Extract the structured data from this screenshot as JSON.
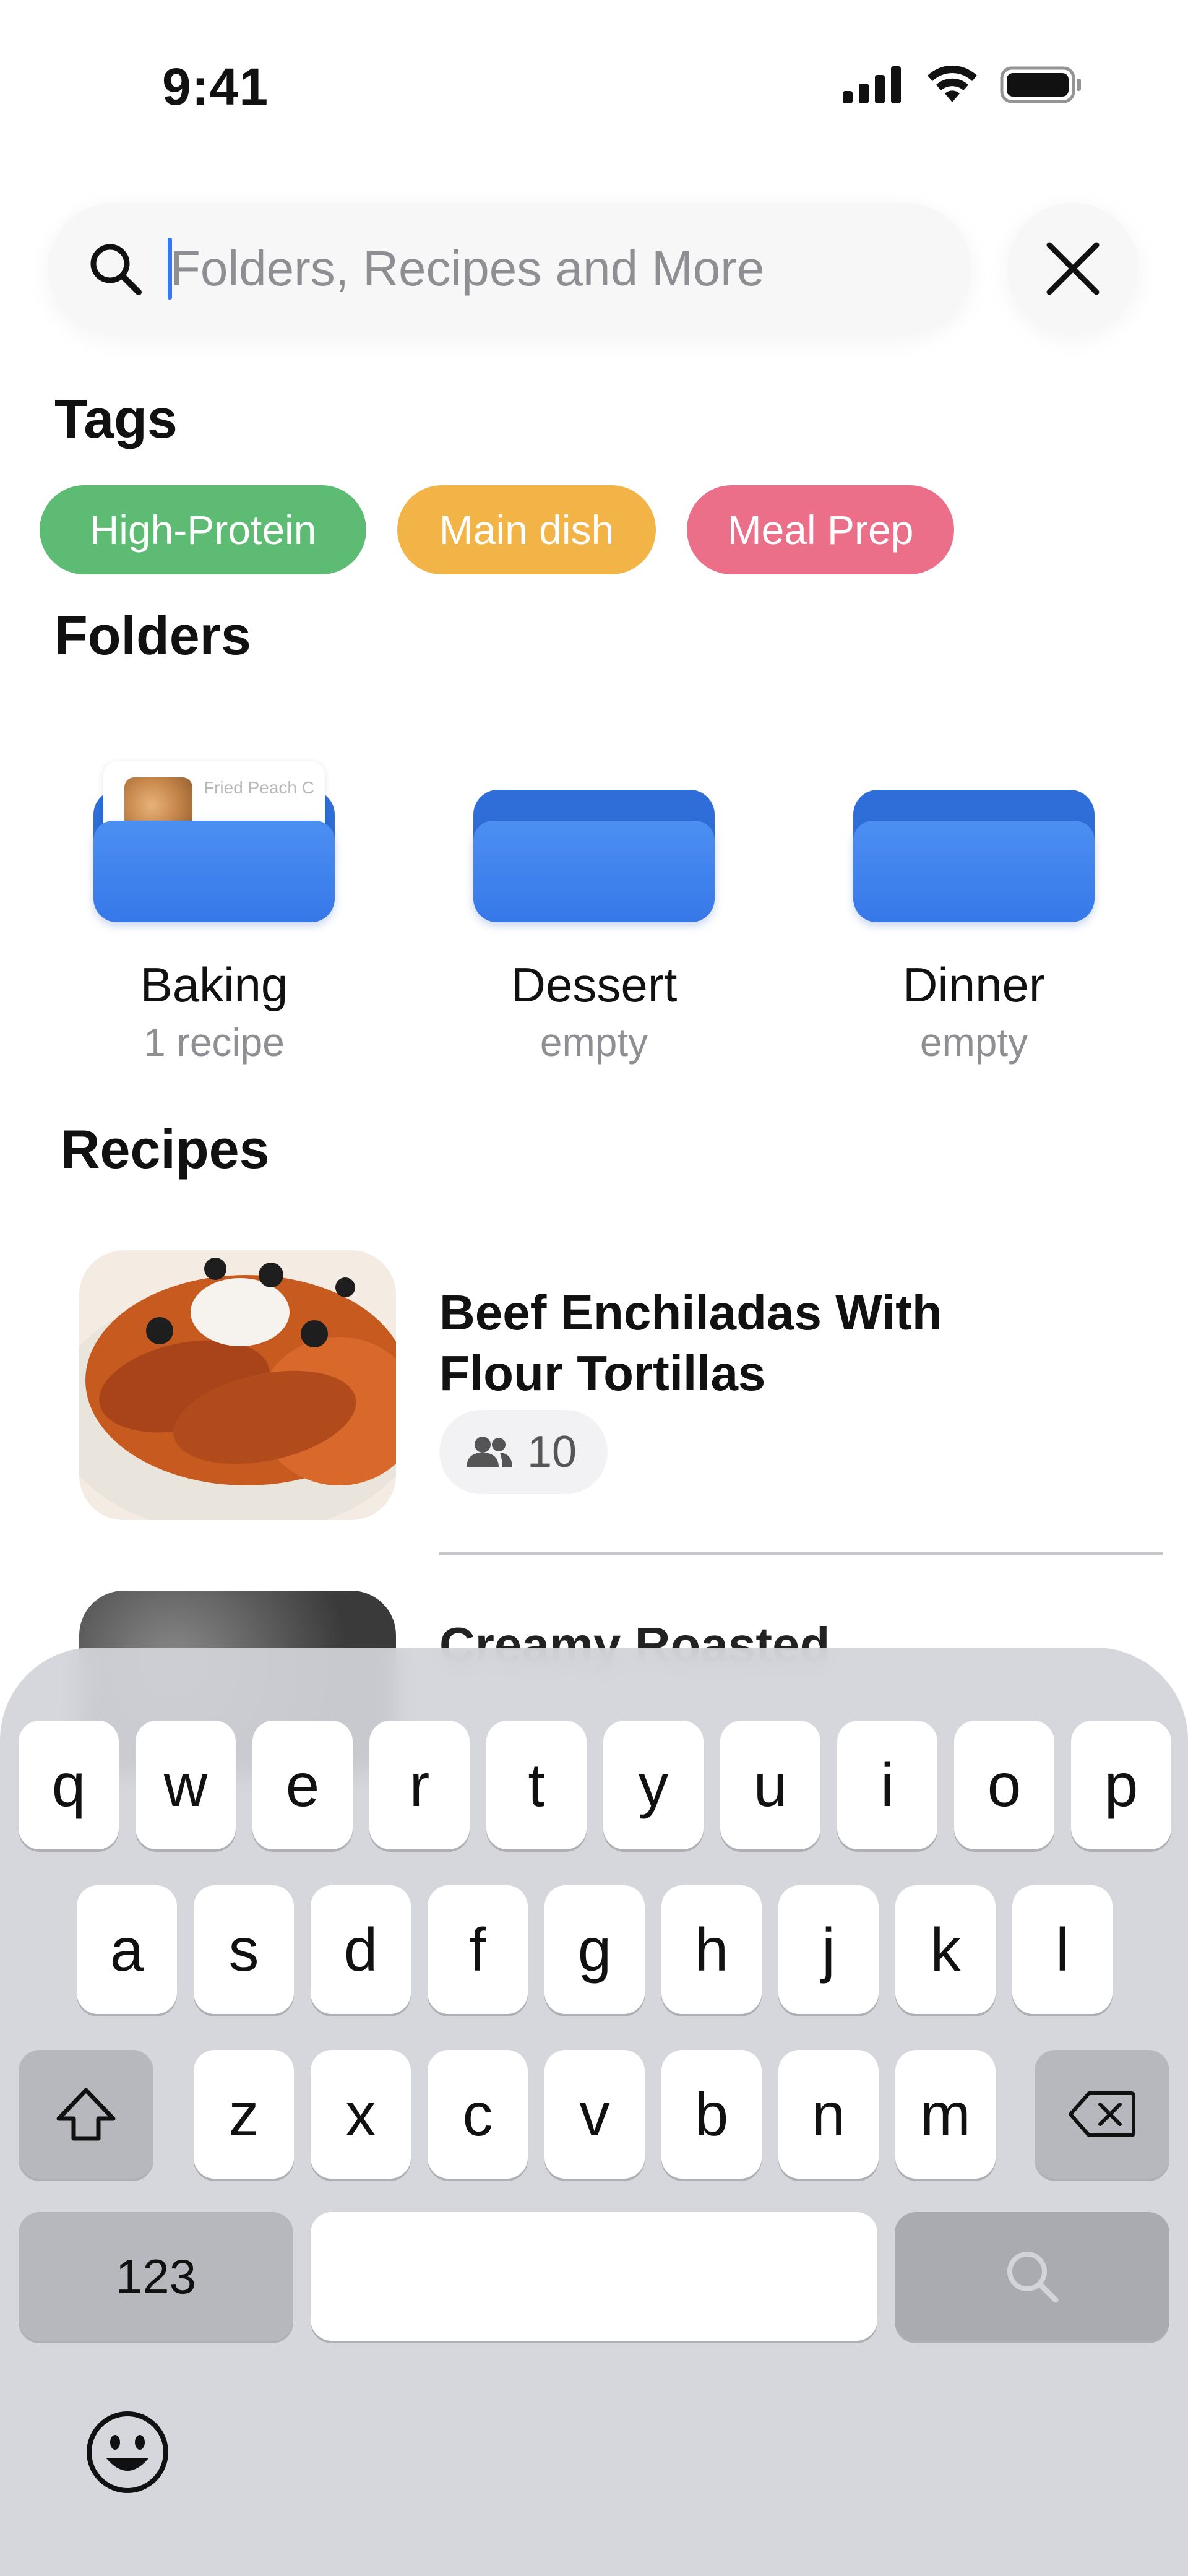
{
  "status_bar": {
    "time": "9:41"
  },
  "search": {
    "placeholder": "Folders, Recipes and More",
    "value": ""
  },
  "tags_section": {
    "title": "Tags",
    "tags": [
      {
        "label": "High-Protein",
        "color": "#5dbb73"
      },
      {
        "label": "Main dish",
        "color": "#f2b446"
      },
      {
        "label": "Meal Prep",
        "color": "#ec6f8a"
      }
    ]
  },
  "folders_section": {
    "title": "Folders",
    "folders": [
      {
        "name": "Baking",
        "count": "1 recipe",
        "preview_text": "Fried Peach Co..."
      },
      {
        "name": "Dessert",
        "count": "empty"
      },
      {
        "name": "Dinner",
        "count": "empty"
      }
    ]
  },
  "recipes_section": {
    "title": "Recipes",
    "items": [
      {
        "title": "Beef Enchiladas With Flour Tortillas",
        "servings": "10",
        "icon": "people-icon"
      },
      {
        "title": "Creamy Roasted"
      }
    ]
  },
  "keyboard": {
    "row1": [
      "q",
      "w",
      "e",
      "r",
      "t",
      "y",
      "u",
      "i",
      "o",
      "p"
    ],
    "row2": [
      "a",
      "s",
      "d",
      "f",
      "g",
      "h",
      "j",
      "k",
      "l"
    ],
    "row3": [
      "z",
      "x",
      "c",
      "v",
      "b",
      "n",
      "m"
    ],
    "numbers_label": "123",
    "icons": {
      "shift": "shift-icon",
      "delete": "delete-icon",
      "search": "search-icon",
      "emoji": "emoji-icon"
    }
  },
  "colors": {
    "accent": "#3478f6",
    "folder_blue": "#3d7ff0"
  }
}
